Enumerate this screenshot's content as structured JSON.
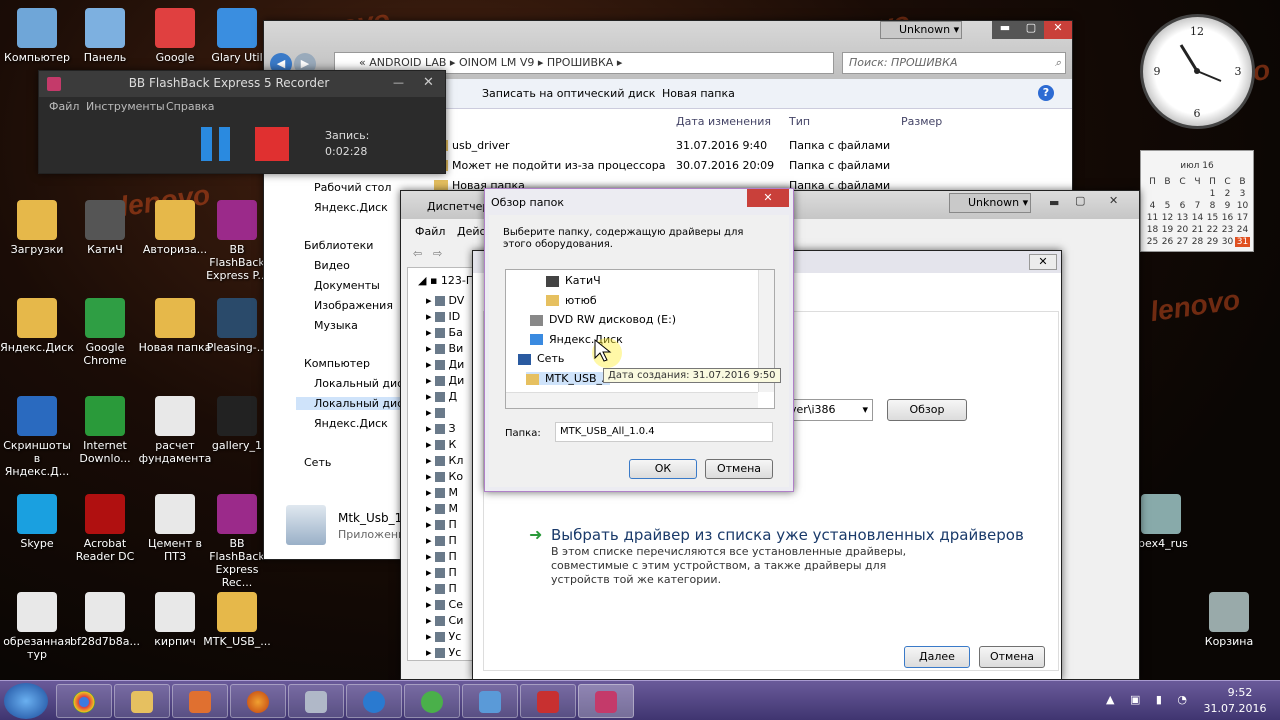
{
  "desktop_icons": [
    {
      "label": "Компьютер",
      "color": "#6fa6d8"
    },
    {
      "label": "Панель",
      "color": "#7db0e0"
    },
    {
      "label": "Google",
      "color": "#e04040"
    },
    {
      "label": "Glary Util",
      "color": "#3a8ee0"
    },
    {
      "label": "Загрузки",
      "color": "#e6b84a"
    },
    {
      "label": "КатиЧ",
      "color": "#555"
    },
    {
      "label": "Авториза...",
      "color": "#e6b84a"
    },
    {
      "label": "BB FlashBack Express P...",
      "color": "#9b2a8a"
    },
    {
      "label": "Яндекс.Диск",
      "color": "#e6b84a"
    },
    {
      "label": "Google Chrome",
      "color": "#2f9e44"
    },
    {
      "label": "Новая папка",
      "color": "#e6b84a"
    },
    {
      "label": "Pleasing-...",
      "color": "#2a4a6a"
    },
    {
      "label": "Скриншоты в Яндекс.Д...",
      "color": "#2a6abf"
    },
    {
      "label": "Internet Downlo...",
      "color": "#2a9a3a"
    },
    {
      "label": "расчет фундамента",
      "color": "#e8e8e8"
    },
    {
      "label": "gallery_1",
      "color": "#222"
    },
    {
      "label": "Skype",
      "color": "#1aa0e0"
    },
    {
      "label": "Acrobat Reader DC",
      "color": "#b01010"
    },
    {
      "label": "Цемент в ПТЗ",
      "color": "#e8e8e8"
    },
    {
      "label": "BB FlashBack Express Rec...",
      "color": "#9b2a8a"
    },
    {
      "label": "обрезанная тур",
      "color": "#e8e8e8"
    },
    {
      "label": "bf28d7b8a...",
      "color": "#e8e8e8"
    },
    {
      "label": "кирпич",
      "color": "#e8e8e8"
    },
    {
      "label": "MTK_USB_...",
      "color": "#e6b84a"
    },
    {
      "label": "Корзина",
      "color": "#9aa"
    },
    {
      "label": "fbex4_rus",
      "color": "#8aa"
    }
  ],
  "recorder": {
    "title": "BB FlashBack Express 5 Recorder",
    "menu": [
      "Файл",
      "Инструменты",
      "Справка"
    ],
    "rec_label": "Запись:",
    "rec_time": "0:02:28"
  },
  "explorer": {
    "breadcrumb": [
      "ANDROID LAB",
      "OINOM LM V9",
      "ПРОШИВКА"
    ],
    "search_placeholder": "Поиск: ПРОШИВКА",
    "user_btn": "Unknown",
    "toolbar": [
      "Записать на оптический диск",
      "Новая папка"
    ],
    "columns": [
      "Дата изменения",
      "Тип",
      "Размер"
    ],
    "files": [
      {
        "name": "usb_driver",
        "date": "31.07.2016 9:40",
        "type": "Папка с файлами"
      },
      {
        "name": "Может не подойти из-за процессора",
        "date": "30.07.2016 20:09",
        "type": "Папка с файлами"
      },
      {
        "name": "Новая папка",
        "date": "",
        "type": "Папка с файлами"
      }
    ],
    "nav": [
      "Рабочий стол",
      "Яндекс.Диск",
      "Библиотеки",
      "Видео",
      "Документы",
      "Изображения",
      "Музыка",
      "Компьютер",
      "Локальный диск",
      "Локальный диск",
      "Яндекс.Диск",
      "Сеть"
    ],
    "status_name": "Mtk_Usb_1...",
    "status_sub": "Приложени..."
  },
  "devmgr": {
    "title": "Диспетчер",
    "menu": [
      "Файл",
      "Дейс"
    ],
    "user_btn": "Unknown",
    "root": "123-П",
    "items": [
      "DV",
      "ID",
      "Ба",
      "Ви",
      "Ди",
      "Ди",
      "Д",
      "",
      "З",
      "К",
      "Кл",
      "Ко",
      "М",
      "М",
      "П",
      "П",
      "П",
      "П",
      "П",
      "Се",
      "Си",
      "Ус",
      "Ус"
    ]
  },
  "wizard": {
    "path_tail": "ver\\i386",
    "browse": "Обзор",
    "option_title": "Выбрать драйвер из списка уже установленных драйверов",
    "option_desc": "В этом списке перечисляются все установленные драйверы, совместимые с этим устройством, а также драйверы для устройств той же категории.",
    "next": "Далее",
    "cancel": "Отмена"
  },
  "browse": {
    "title": "Обзор папок",
    "hint": "Выберите папку, содержащую драйверы для этого оборудования.",
    "tree": [
      "КатиЧ",
      "ютюб",
      "DVD RW дисковод (E:)",
      "Яндекс.Диск",
      "Сеть",
      "MTK_USB_A"
    ],
    "tooltip": "Дата создания: 31.07.2016 9:50",
    "folder_label": "Папка:",
    "folder_value": "MTK_USB_All_1.0.4",
    "ok": "ОК",
    "cancel": "Отмена"
  },
  "calendar": {
    "month": "июл 16",
    "days": [
      "П",
      "В",
      "С",
      "Ч",
      "П",
      "С",
      "В"
    ],
    "weeks": [
      [
        "",
        "",
        "",
        "",
        "1",
        "2",
        "3"
      ],
      [
        "4",
        "5",
        "6",
        "7",
        "8",
        "9",
        "10"
      ],
      [
        "11",
        "12",
        "13",
        "14",
        "15",
        "16",
        "17"
      ],
      [
        "18",
        "19",
        "20",
        "21",
        "22",
        "23",
        "24"
      ],
      [
        "25",
        "26",
        "27",
        "28",
        "29",
        "30",
        "31"
      ]
    ]
  },
  "taskbar": {
    "time": "9:52",
    "date": "31.07.2016"
  },
  "watermark": "lenovo"
}
